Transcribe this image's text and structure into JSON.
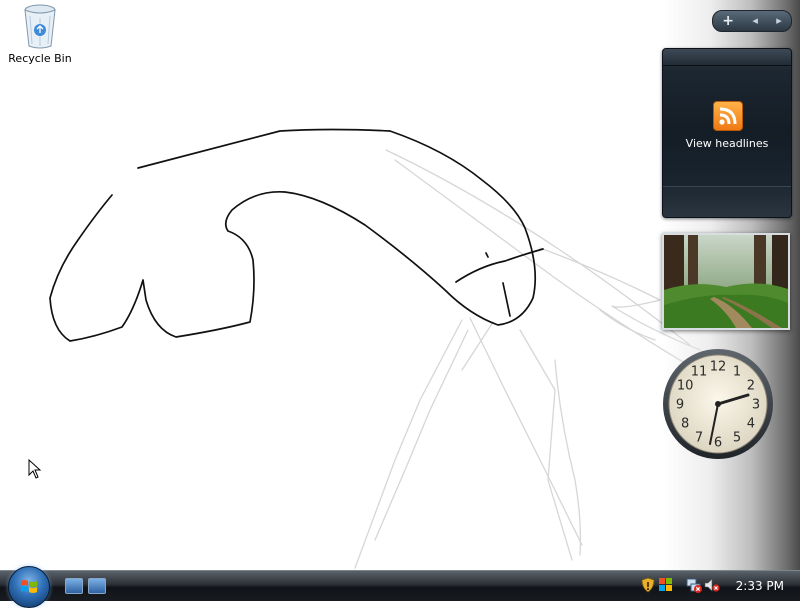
{
  "desktop": {
    "icons": [
      {
        "label": "Recycle Bin",
        "icon": "recycle-bin-icon"
      }
    ]
  },
  "sidebar": {
    "controls": {
      "add_label": "+",
      "prev_label": "◂",
      "next_label": "▸"
    },
    "feed_gadget": {
      "label": "View headlines",
      "icon": "rss-feed-icon",
      "accent": "#f3871f"
    },
    "slideshow_gadget": {
      "subject": "forest-path-photo"
    },
    "clock_gadget": {
      "hours": [
        "12",
        "1",
        "2",
        "3",
        "4",
        "5",
        "6",
        "7",
        "8",
        "9",
        "10",
        "11"
      ],
      "time_shown": "2:33"
    }
  },
  "taskbar": {
    "start_button": "windows-start-orb",
    "quick_launch": [
      "show-desktop-icon",
      "switch-windows-icon"
    ],
    "tray_icons": [
      "security-shield-icon",
      "windows-update-icon",
      "network-disconnected-icon",
      "volume-muted-icon"
    ],
    "clock": "2:33 PM"
  },
  "colors": {
    "taskbar": "#1c2026",
    "sidebar_dark": "#4a4a4a",
    "rss_orange": "#f3871f",
    "scribble_dark": "#111111",
    "scribble_light": "#d8d8d8"
  }
}
